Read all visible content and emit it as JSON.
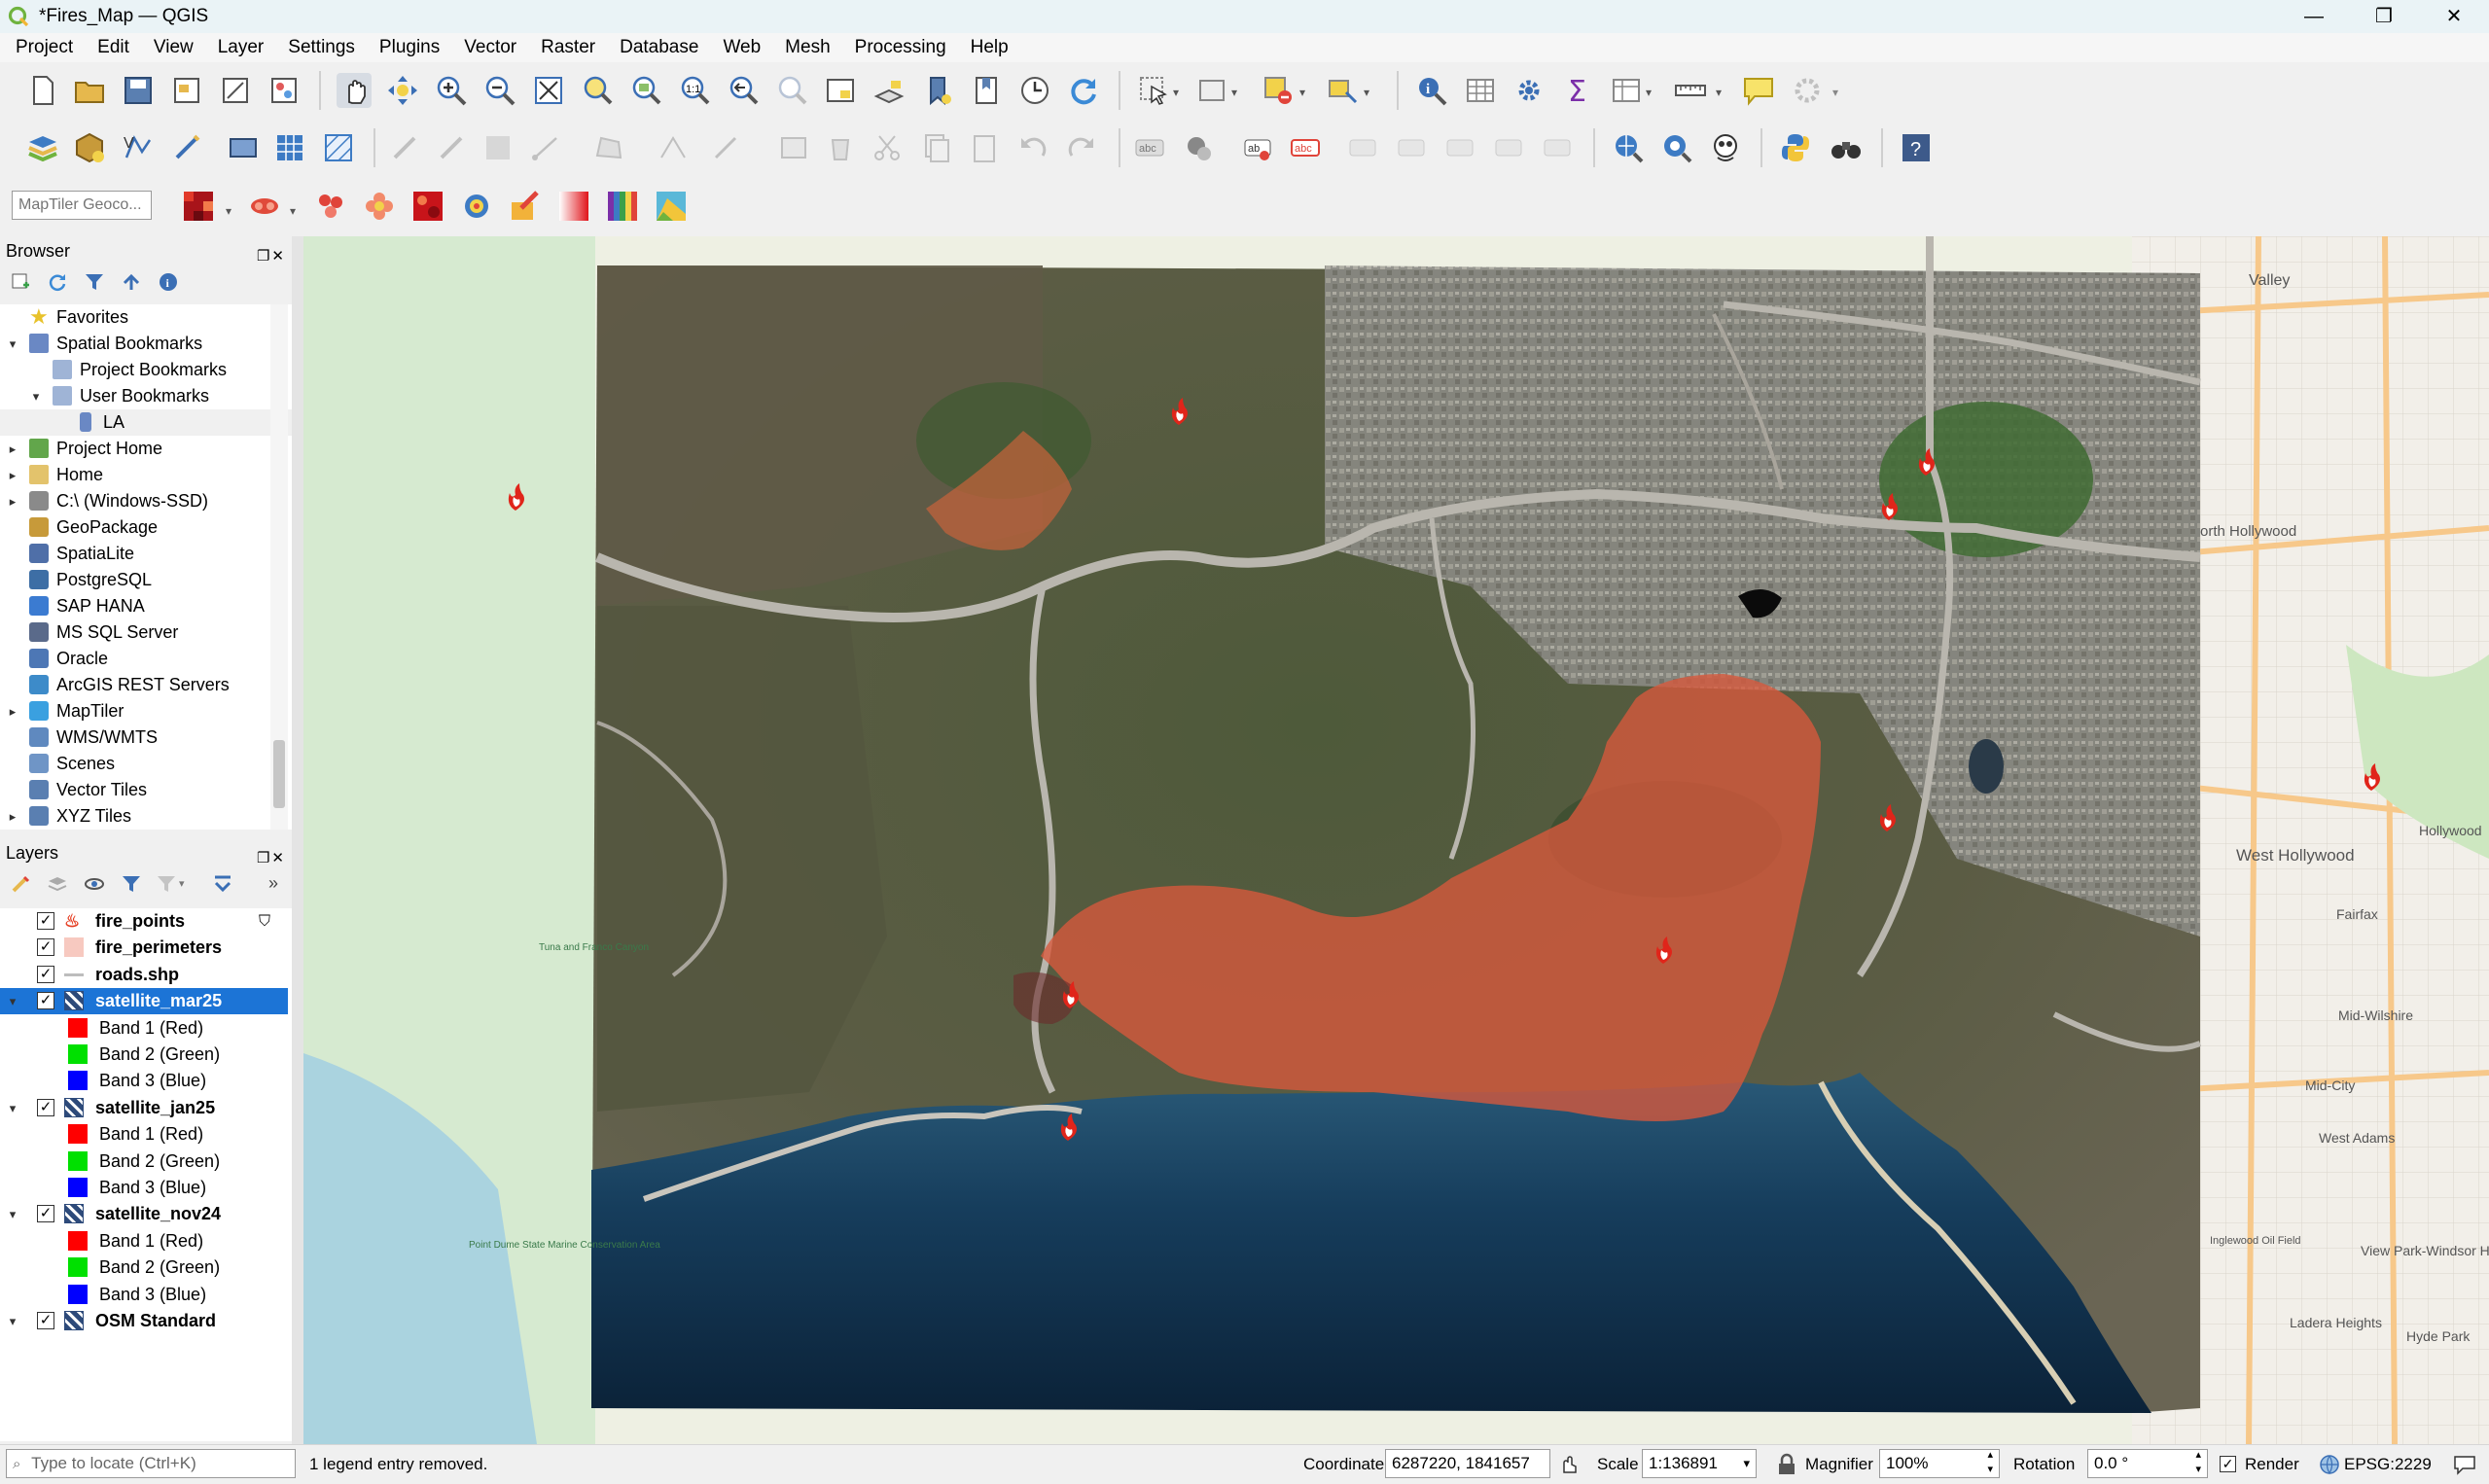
{
  "window": {
    "title": "*Fires_Map — QGIS",
    "minimize": "—",
    "maximize": "❐",
    "close": "✕"
  },
  "menu": [
    "Project",
    "Edit",
    "View",
    "Layer",
    "Settings",
    "Plugins",
    "Vector",
    "Raster",
    "Database",
    "Web",
    "Mesh",
    "Processing",
    "Help"
  ],
  "toolbar3": {
    "geocoder_placeholder": "MapTiler Geoco..."
  },
  "browser": {
    "title": "Browser",
    "items": [
      {
        "label": "Favorites",
        "indent": 0,
        "arrow": "",
        "icon": "star-icon",
        "color": "#e8c22b"
      },
      {
        "label": "Spatial Bookmarks",
        "indent": 0,
        "arrow": "▾",
        "icon": "bookmark-folder-icon",
        "color": "#6a88c4"
      },
      {
        "label": "Project Bookmarks",
        "indent": 1,
        "arrow": "",
        "icon": "folder-icon",
        "color": "#9fb4d6"
      },
      {
        "label": "User Bookmarks",
        "indent": 1,
        "arrow": "▾",
        "icon": "folder-icon",
        "color": "#9fb4d6"
      },
      {
        "label": "LA",
        "indent": 2,
        "arrow": "",
        "icon": "bookmark-icon",
        "color": "#6a88c4"
      },
      {
        "label": "Project Home",
        "indent": 0,
        "arrow": "▸",
        "icon": "home-folder-icon",
        "color": "#62a64b"
      },
      {
        "label": "Home",
        "indent": 0,
        "arrow": "▸",
        "icon": "folder-icon",
        "color": "#e3c36c"
      },
      {
        "label": "C:\\ (Windows-SSD)",
        "indent": 0,
        "arrow": "▸",
        "icon": "drive-icon",
        "color": "#8a8a8a"
      },
      {
        "label": "GeoPackage",
        "indent": 0,
        "arrow": "",
        "icon": "geopackage-icon",
        "color": "#c79a3a"
      },
      {
        "label": "SpatiaLite",
        "indent": 0,
        "arrow": "",
        "icon": "spatialite-icon",
        "color": "#4f6fa8"
      },
      {
        "label": "PostgreSQL",
        "indent": 0,
        "arrow": "",
        "icon": "postgresql-icon",
        "color": "#3d6ea5"
      },
      {
        "label": "SAP HANA",
        "indent": 0,
        "arrow": "",
        "icon": "saphana-icon",
        "color": "#3b7bd1"
      },
      {
        "label": "MS SQL Server",
        "indent": 0,
        "arrow": "",
        "icon": "mssql-icon",
        "color": "#5a6a8a"
      },
      {
        "label": "Oracle",
        "indent": 0,
        "arrow": "",
        "icon": "oracle-icon",
        "color": "#4d77b5"
      },
      {
        "label": "ArcGIS REST Servers",
        "indent": 0,
        "arrow": "",
        "icon": "arcgis-icon",
        "color": "#3d8bc9"
      },
      {
        "label": "MapTiler",
        "indent": 0,
        "arrow": "▸",
        "icon": "maptiler-icon",
        "color": "#3aa0e0"
      },
      {
        "label": "WMS/WMTS",
        "indent": 0,
        "arrow": "",
        "icon": "wms-icon",
        "color": "#5f89bf"
      },
      {
        "label": "Scenes",
        "indent": 0,
        "arrow": "",
        "icon": "scenes-icon",
        "color": "#6f95c6"
      },
      {
        "label": "Vector Tiles",
        "indent": 0,
        "arrow": "",
        "icon": "vector-tiles-icon",
        "color": "#5a7fb1"
      },
      {
        "label": "XYZ Tiles",
        "indent": 0,
        "arrow": "▸",
        "icon": "xyz-tiles-icon",
        "color": "#5a7fb1"
      }
    ]
  },
  "layers": {
    "title": "Layers",
    "items": [
      {
        "label": "fire_points",
        "indent": 0,
        "arrow": "",
        "checked": true,
        "swatch": "fire-icon",
        "color": "#e53b1f",
        "bold": true,
        "selected": false,
        "filter": true
      },
      {
        "label": "fire_perimeters",
        "indent": 0,
        "arrow": "",
        "checked": true,
        "swatch": "polygon-swatch",
        "color": "#f7c9c0",
        "bold": true,
        "selected": false
      },
      {
        "label": "roads.shp",
        "indent": 0,
        "arrow": "",
        "checked": true,
        "swatch": "line-swatch",
        "color": "#bdbdbd",
        "bold": true,
        "selected": false
      },
      {
        "label": "satellite_mar25",
        "indent": 0,
        "arrow": "▾",
        "checked": true,
        "swatch": "raster-icon",
        "color": "#2d4a7a",
        "bold": true,
        "selected": true
      },
      {
        "label": "Band 1 (Red)",
        "indent": 1,
        "arrow": "",
        "checked": null,
        "swatch": "color-swatch",
        "color": "#ff0000",
        "bold": false,
        "selected": false
      },
      {
        "label": "Band 2 (Green)",
        "indent": 1,
        "arrow": "",
        "checked": null,
        "swatch": "color-swatch",
        "color": "#00e000",
        "bold": false,
        "selected": false
      },
      {
        "label": "Band 3 (Blue)",
        "indent": 1,
        "arrow": "",
        "checked": null,
        "swatch": "color-swatch",
        "color": "#0000ff",
        "bold": false,
        "selected": false
      },
      {
        "label": "satellite_jan25",
        "indent": 0,
        "arrow": "▾",
        "checked": true,
        "swatch": "raster-icon",
        "color": "#2d4a7a",
        "bold": true,
        "selected": false
      },
      {
        "label": "Band 1 (Red)",
        "indent": 1,
        "arrow": "",
        "checked": null,
        "swatch": "color-swatch",
        "color": "#ff0000",
        "bold": false,
        "selected": false
      },
      {
        "label": "Band 2 (Green)",
        "indent": 1,
        "arrow": "",
        "checked": null,
        "swatch": "color-swatch",
        "color": "#00e000",
        "bold": false,
        "selected": false
      },
      {
        "label": "Band 3 (Blue)",
        "indent": 1,
        "arrow": "",
        "checked": null,
        "swatch": "color-swatch",
        "color": "#0000ff",
        "bold": false,
        "selected": false
      },
      {
        "label": "satellite_nov24",
        "indent": 0,
        "arrow": "▾",
        "checked": true,
        "swatch": "raster-icon",
        "color": "#2d4a7a",
        "bold": true,
        "selected": false
      },
      {
        "label": "Band 1 (Red)",
        "indent": 1,
        "arrow": "",
        "checked": null,
        "swatch": "color-swatch",
        "color": "#ff0000",
        "bold": false,
        "selected": false
      },
      {
        "label": "Band 2 (Green)",
        "indent": 1,
        "arrow": "",
        "checked": null,
        "swatch": "color-swatch",
        "color": "#00e000",
        "bold": false,
        "selected": false
      },
      {
        "label": "Band 3 (Blue)",
        "indent": 1,
        "arrow": "",
        "checked": null,
        "swatch": "color-swatch",
        "color": "#0000ff",
        "bold": false,
        "selected": false
      },
      {
        "label": "OSM Standard",
        "indent": 0,
        "arrow": "▾",
        "checked": true,
        "swatch": "raster-icon",
        "color": "#2d4a7a",
        "bold": true,
        "selected": false
      }
    ]
  },
  "map_labels": [
    {
      "text": "Valley"
    },
    {
      "text": "orth Hollywood"
    },
    {
      "text": "Hollywood"
    },
    {
      "text": "West Hollywood"
    },
    {
      "text": "Fairfax"
    },
    {
      "text": "Mid-Wilshire"
    },
    {
      "text": "Mid-City"
    },
    {
      "text": "West Adams"
    },
    {
      "text": "View Park-Windsor Hills"
    },
    {
      "text": "Ladera Heights"
    },
    {
      "text": "Hyde Park"
    },
    {
      "text": "Inglewood Oil Field"
    },
    {
      "text": "Point Dume State Marine Conservation Area"
    },
    {
      "text": "Tuna and Franco Canyon"
    }
  ],
  "status": {
    "locate_placeholder": "Type to locate (Ctrl+K)",
    "message": "1 legend entry removed.",
    "coordinate_label": "Coordinate",
    "coordinate_value": "6287220, 1841657",
    "scale_label": "Scale",
    "scale_value": "1:136891",
    "magnifier_label": "Magnifier",
    "magnifier_value": "100%",
    "rotation_label": "Rotation",
    "rotation_value": "0.0 °",
    "render_label": "Render",
    "crs": "EPSG:2229"
  }
}
